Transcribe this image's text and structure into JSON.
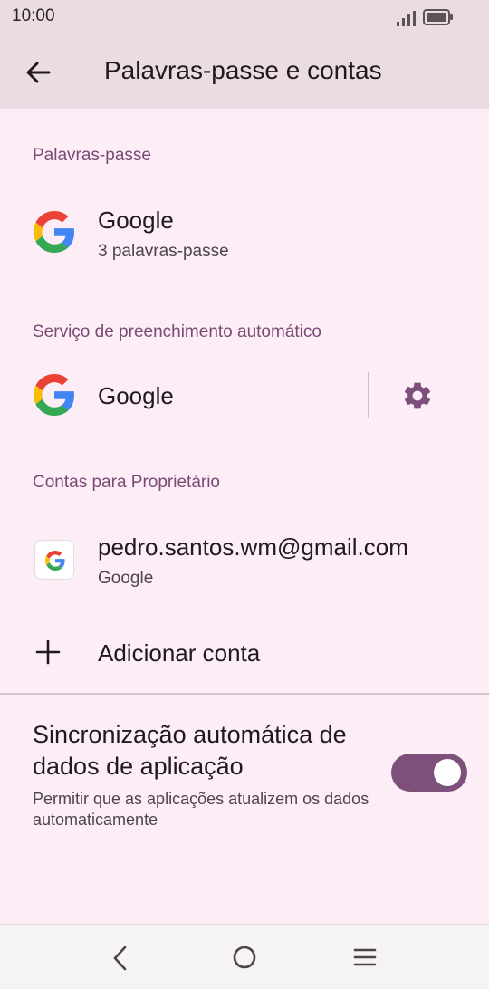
{
  "status_bar": {
    "time": "10:00",
    "icons": [
      "signal-icon",
      "battery-icon"
    ]
  },
  "app_bar": {
    "title": "Palavras-passe e contas",
    "back_icon": "back-arrow-icon"
  },
  "passwords_section": {
    "header": "Palavras-passe",
    "item": {
      "title": "Google",
      "subtitle": "3 palavras-passe",
      "icon": "google-logo-icon"
    }
  },
  "autofill_section": {
    "header": "Serviço de preenchimento automático",
    "item": {
      "title": "Google",
      "icon": "google-logo-icon",
      "settings_icon": "gear-icon"
    }
  },
  "accounts_section": {
    "header": "Contas para Proprietário",
    "account": {
      "email": "pedro.santos.wm@gmail.com",
      "provider": "Google",
      "icon": "google-logo-icon"
    },
    "add_account": {
      "label": "Adicionar conta",
      "icon": "plus-icon"
    }
  },
  "auto_sync": {
    "title": "Sincronização automática de dados de aplicação",
    "description": "Permitir que as aplicações atualizem os dados automaticamente",
    "enabled": true
  },
  "nav_bar": {
    "icons": [
      "back-icon",
      "home-icon",
      "menu-icon"
    ]
  },
  "colors": {
    "accent": "#7d4f7b",
    "section_header": "#7a4a75",
    "background": "#fcedf6",
    "app_bar": "#ebdbe3"
  }
}
